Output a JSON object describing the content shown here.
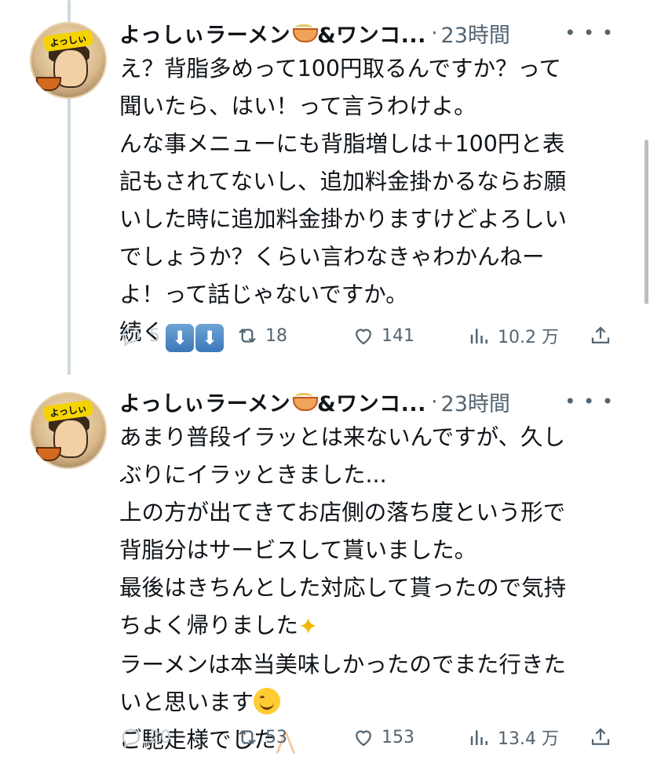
{
  "tweets": [
    {
      "author": "よっしぃラーメン",
      "author_suffix": "&ワンコ...",
      "time": "23時間",
      "avatar_label": "よっしぃ",
      "lines": [
        "え？背脂多めって100円取るんですか？って",
        "聞いたら、はい！って言うわけよ。",
        "んな事メニューにも背脂増しは＋100円と表",
        "記もされてないし、追加料金掛かるならお願",
        "いした時に追加料金掛かりますけどよろしい",
        "でしょうか？くらい言わなきゃわかんねー",
        "よ！って話じゃないですか。",
        "続く"
      ],
      "replies": "5",
      "retweets": "18",
      "likes": "141",
      "views": "10.2 万"
    },
    {
      "author": "よっしぃラーメン",
      "author_suffix": "&ワンコ...",
      "time": "23時間",
      "avatar_label": "よっしぃ",
      "lines": [
        "あまり普段イラッとは来ないんですが、久し",
        "ぶりにイラッときました...",
        "上の方が出てきてお店側の落ち度という形で",
        "背脂分はサービスして貰いました。",
        "最後はきちんとした対応して貰ったので気持",
        "ちよく帰りました",
        "ラーメンは本当美味しかったのでまた行きた",
        "いと思います",
        "ご馳走様でした"
      ],
      "replies": "20",
      "retweets": "53",
      "likes": "153",
      "views": "13.4 万"
    }
  ],
  "icons": {
    "more": "more-icon",
    "reply": "reply-icon",
    "retweet": "retweet-icon",
    "like": "heart-icon",
    "views": "views-icon",
    "share": "share-icon",
    "down_arrow": "⬇"
  },
  "colors": {
    "text": "#0f1419",
    "muted": "#536471",
    "thread_line": "#cfd9de"
  }
}
